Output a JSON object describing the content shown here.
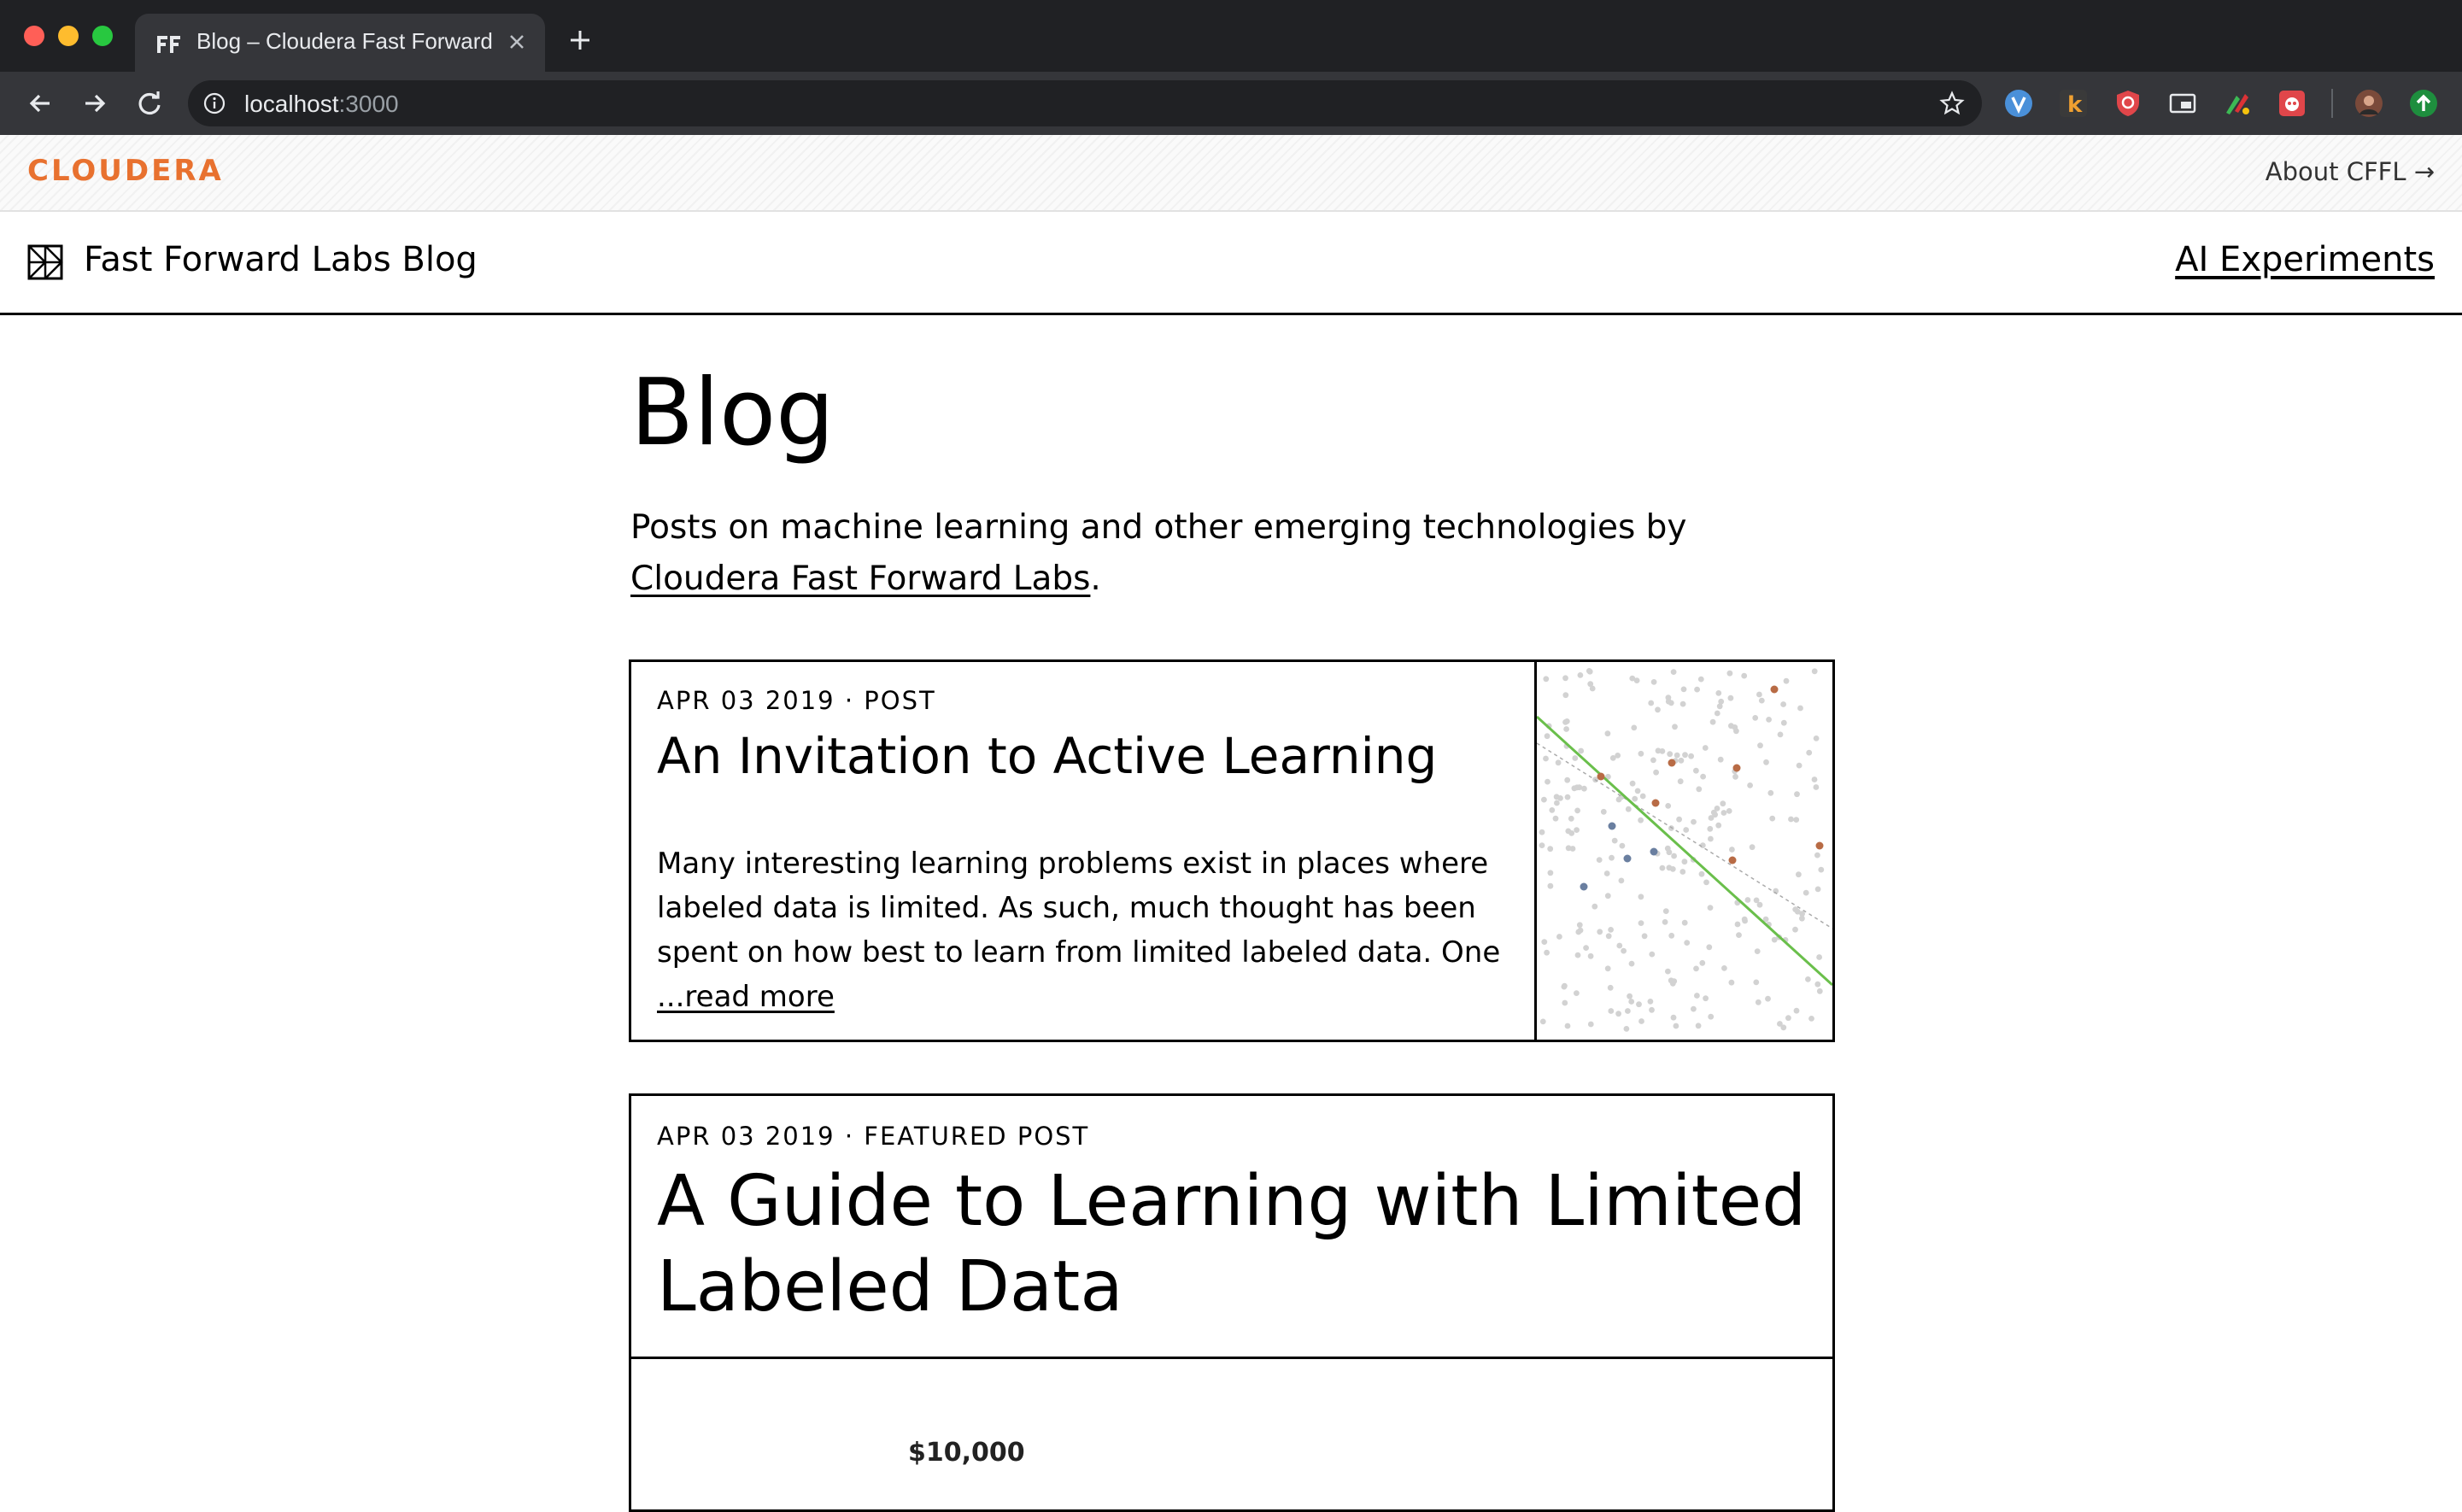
{
  "browser": {
    "tab_title": "Blog – Cloudera Fast Forward",
    "url_host": "localhost",
    "url_port": ":3000"
  },
  "topbar": {
    "brand": "CLOUDERA",
    "about_link": "About CFFL →"
  },
  "site_nav": {
    "title": "Fast Forward Labs Blog",
    "ai_experiments": "AI Experiments"
  },
  "page": {
    "title": "Blog",
    "intro_text": "Posts on machine learning and other emerging technologies by",
    "intro_link": "Cloudera Fast Forward Labs",
    "intro_period": "."
  },
  "posts": [
    {
      "meta": "APR 03 2019 · POST",
      "title": "An Invitation to Active Learning",
      "excerpt": "Many interesting learning problems exist in places where labeled data is limited. As such, much thought has been spent on how best to learn from limited labeled data. One",
      "read_more": "...read more",
      "thumbnail": "scatter-plot-decision-boundary"
    },
    {
      "meta": "APR 03 2019 · FEATURED POST",
      "title": "A Guide to Learning with Limited Labeled Data",
      "image_label": "$10,000"
    }
  ],
  "colors": {
    "brand_orange": "#e8712f",
    "boundary_green": "#6abf4b",
    "point_orange": "#b86b45",
    "point_blue": "#6a7fa0"
  }
}
